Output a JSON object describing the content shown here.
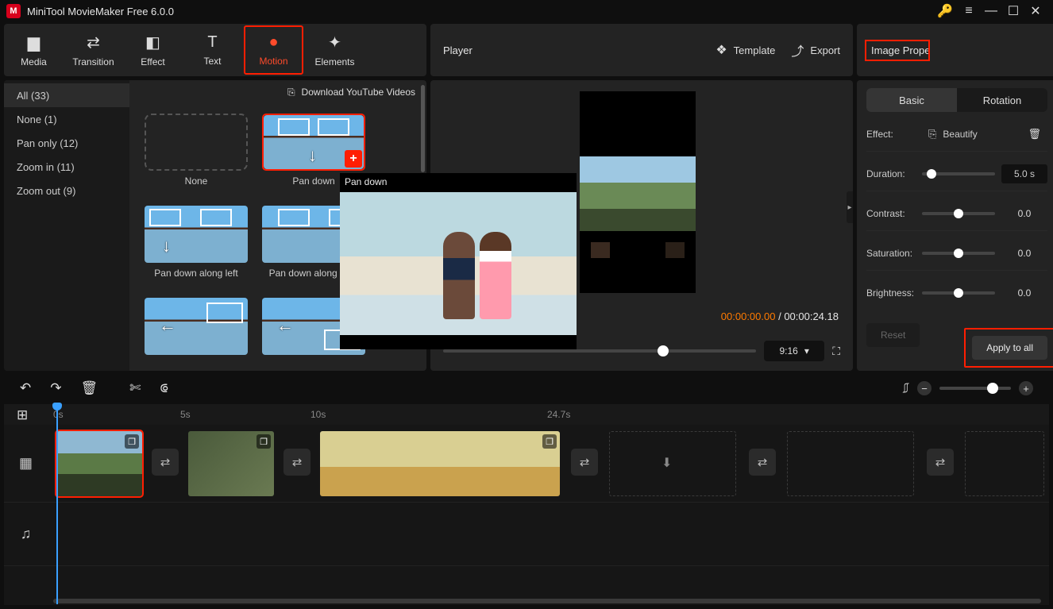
{
  "title": "MiniTool MovieMaker Free 6.0.0",
  "tabs": {
    "media": "Media",
    "transition": "Transition",
    "effect": "Effect",
    "text": "Text",
    "motion": "Motion",
    "elements": "Elements"
  },
  "playerHeader": {
    "title": "Player",
    "template": "Template",
    "export": "Export"
  },
  "propsHeader": {
    "title": "Image Property"
  },
  "categories": [
    {
      "label": "All (33)",
      "active": true
    },
    {
      "label": "None (1)"
    },
    {
      "label": "Pan only (12)"
    },
    {
      "label": "Zoom in (11)"
    },
    {
      "label": "Zoom out (9)"
    }
  ],
  "download": "Download YouTube Videos",
  "motions": [
    {
      "label": "None",
      "kind": "none"
    },
    {
      "label": "Pan down",
      "kind": "pandown",
      "selected": true
    },
    {
      "label": "Pan down along left",
      "kind": "pdl"
    },
    {
      "label": "Pan down along right",
      "kind": "pdr"
    },
    {
      "label": "",
      "kind": "pl"
    },
    {
      "label": "",
      "kind": "pla"
    }
  ],
  "popup": {
    "title": "Pan down"
  },
  "time": {
    "current": "00:00:00.00",
    "sep": " / ",
    "total": "00:00:24.18"
  },
  "aspect": "9:16",
  "props": {
    "basic": "Basic",
    "rotation": "Rotation",
    "effectLabel": "Effect:",
    "effectValue": "Beautify",
    "duration": {
      "label": "Duration:",
      "value": "5.0 s"
    },
    "contrast": {
      "label": "Contrast:",
      "value": "0.0"
    },
    "saturation": {
      "label": "Saturation:",
      "value": "0.0"
    },
    "brightness": {
      "label": "Brightness:",
      "value": "0.0"
    },
    "reset": "Reset",
    "apply": "Apply to all"
  },
  "ruler": {
    "t0": "0s",
    "t1": "5s",
    "t2": "10s",
    "t3": "24.7s"
  }
}
